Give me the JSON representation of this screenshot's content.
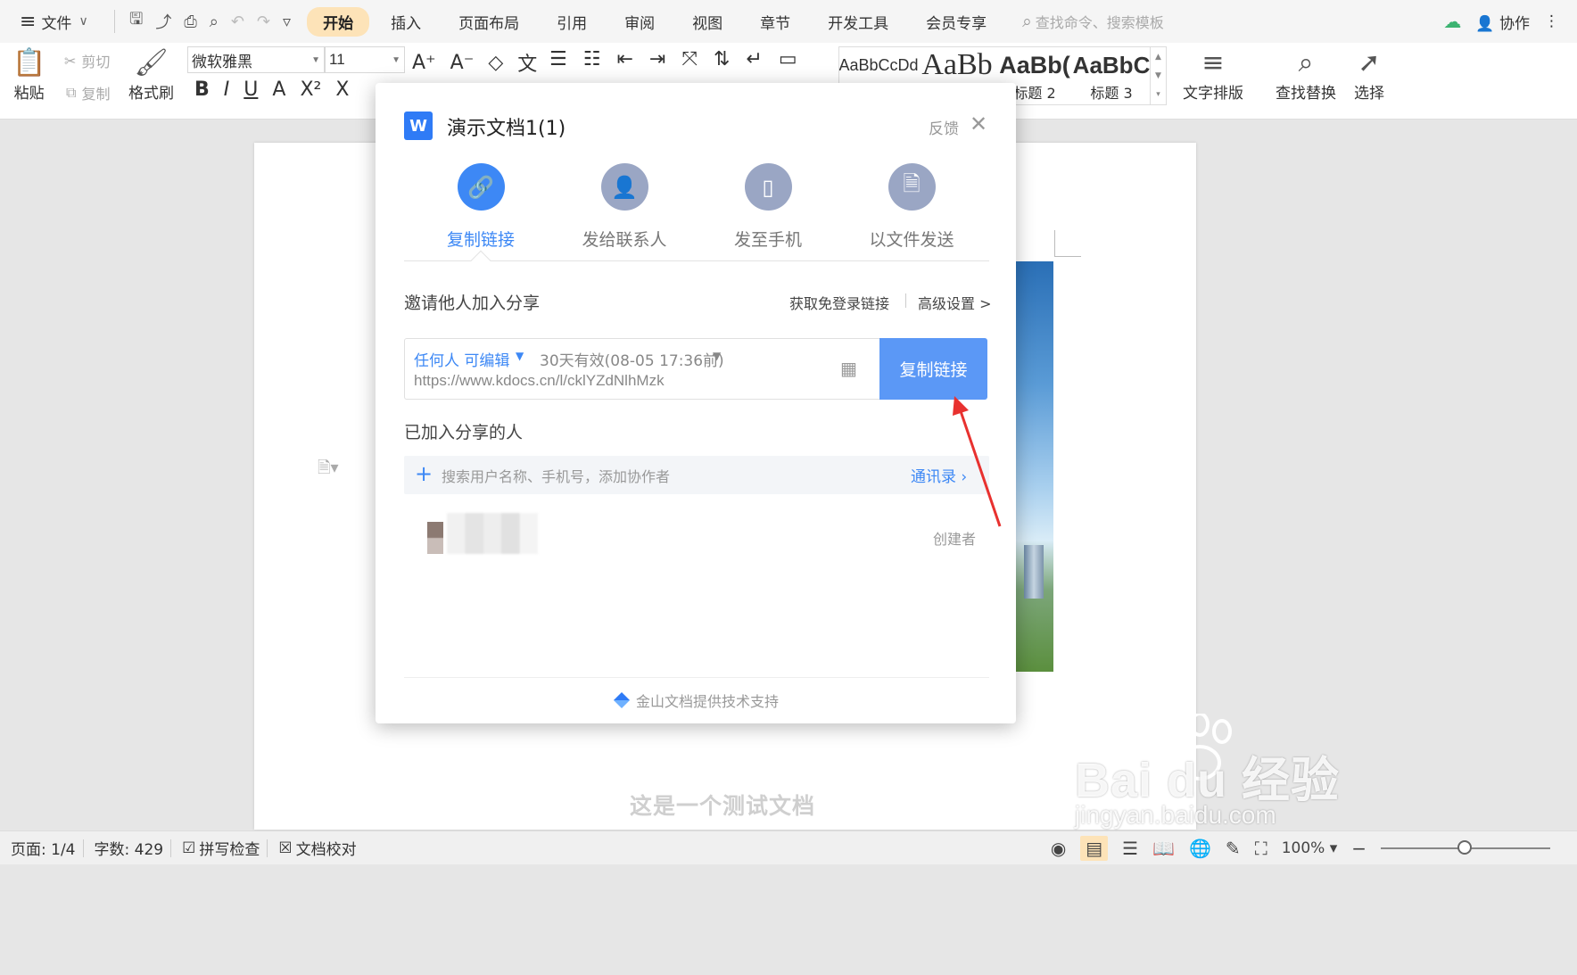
{
  "menubar": {
    "file_label": "文件",
    "tabs": [
      {
        "label": "开始",
        "active": true
      },
      {
        "label": "插入"
      },
      {
        "label": "页面布局"
      },
      {
        "label": "引用"
      },
      {
        "label": "审阅"
      },
      {
        "label": "视图"
      },
      {
        "label": "章节"
      },
      {
        "label": "开发工具"
      },
      {
        "label": "会员专享"
      }
    ],
    "search_placeholder": "查找命令、搜索模板",
    "collab_label": "协作"
  },
  "ribbon": {
    "paste": "粘贴",
    "cut": "剪切",
    "copy": "复制",
    "format_painter": "格式刷",
    "font_name": "微软雅黑",
    "font_size": "11",
    "styles": [
      {
        "sample": "AaBbCcDd",
        "caption": ""
      },
      {
        "sample": "AaBb",
        "caption": ""
      },
      {
        "sample": "AaBb(",
        "caption": "标题 2"
      },
      {
        "sample": "AaBbC",
        "caption": "标题 3"
      }
    ],
    "text_layout": "文字排版",
    "find_replace": "查找替换",
    "select": "选择"
  },
  "document": {
    "body_text": "这是一个测试文档"
  },
  "dialog": {
    "title": "演示文档1(1)",
    "feedback": "反馈",
    "options": [
      {
        "label": "复制链接",
        "icon": "link-icon",
        "active": true
      },
      {
        "label": "发给联系人",
        "icon": "person-icon"
      },
      {
        "label": "发至手机",
        "icon": "phone-icon"
      },
      {
        "label": "以文件发送",
        "icon": "file-icon"
      }
    ],
    "invite_label": "邀请他人加入分享",
    "get_login_free_link": "获取免登录链接",
    "advanced_settings": "高级设置 >",
    "permission": "任何人 可编辑",
    "validity": "30天有效(08-05 17:36前)",
    "url": "https://www.kdocs.cn/l/cklYZdNlhMzk",
    "copy_button": "复制链接",
    "joined_label": "已加入分享的人",
    "user_search_placeholder": "搜索用户名称、手机号，添加协作者",
    "contacts": "通讯录",
    "creator_role": "创建者",
    "footer": "金山文档提供技术支持"
  },
  "statusbar": {
    "page": "页面: 1/4",
    "words": "字数: 429",
    "spell_check": "拼写检查",
    "doc_proof": "文档校对",
    "zoom": "100%"
  },
  "watermark": {
    "main": "Bai du 经验",
    "sub": "jingyan.baidu.com"
  },
  "colors": {
    "accent_blue": "#3d88f5",
    "copy_button_bg": "#5b98f6",
    "active_tab_bg": "#fde3b8",
    "annotation_arrow": "#e8312f"
  }
}
